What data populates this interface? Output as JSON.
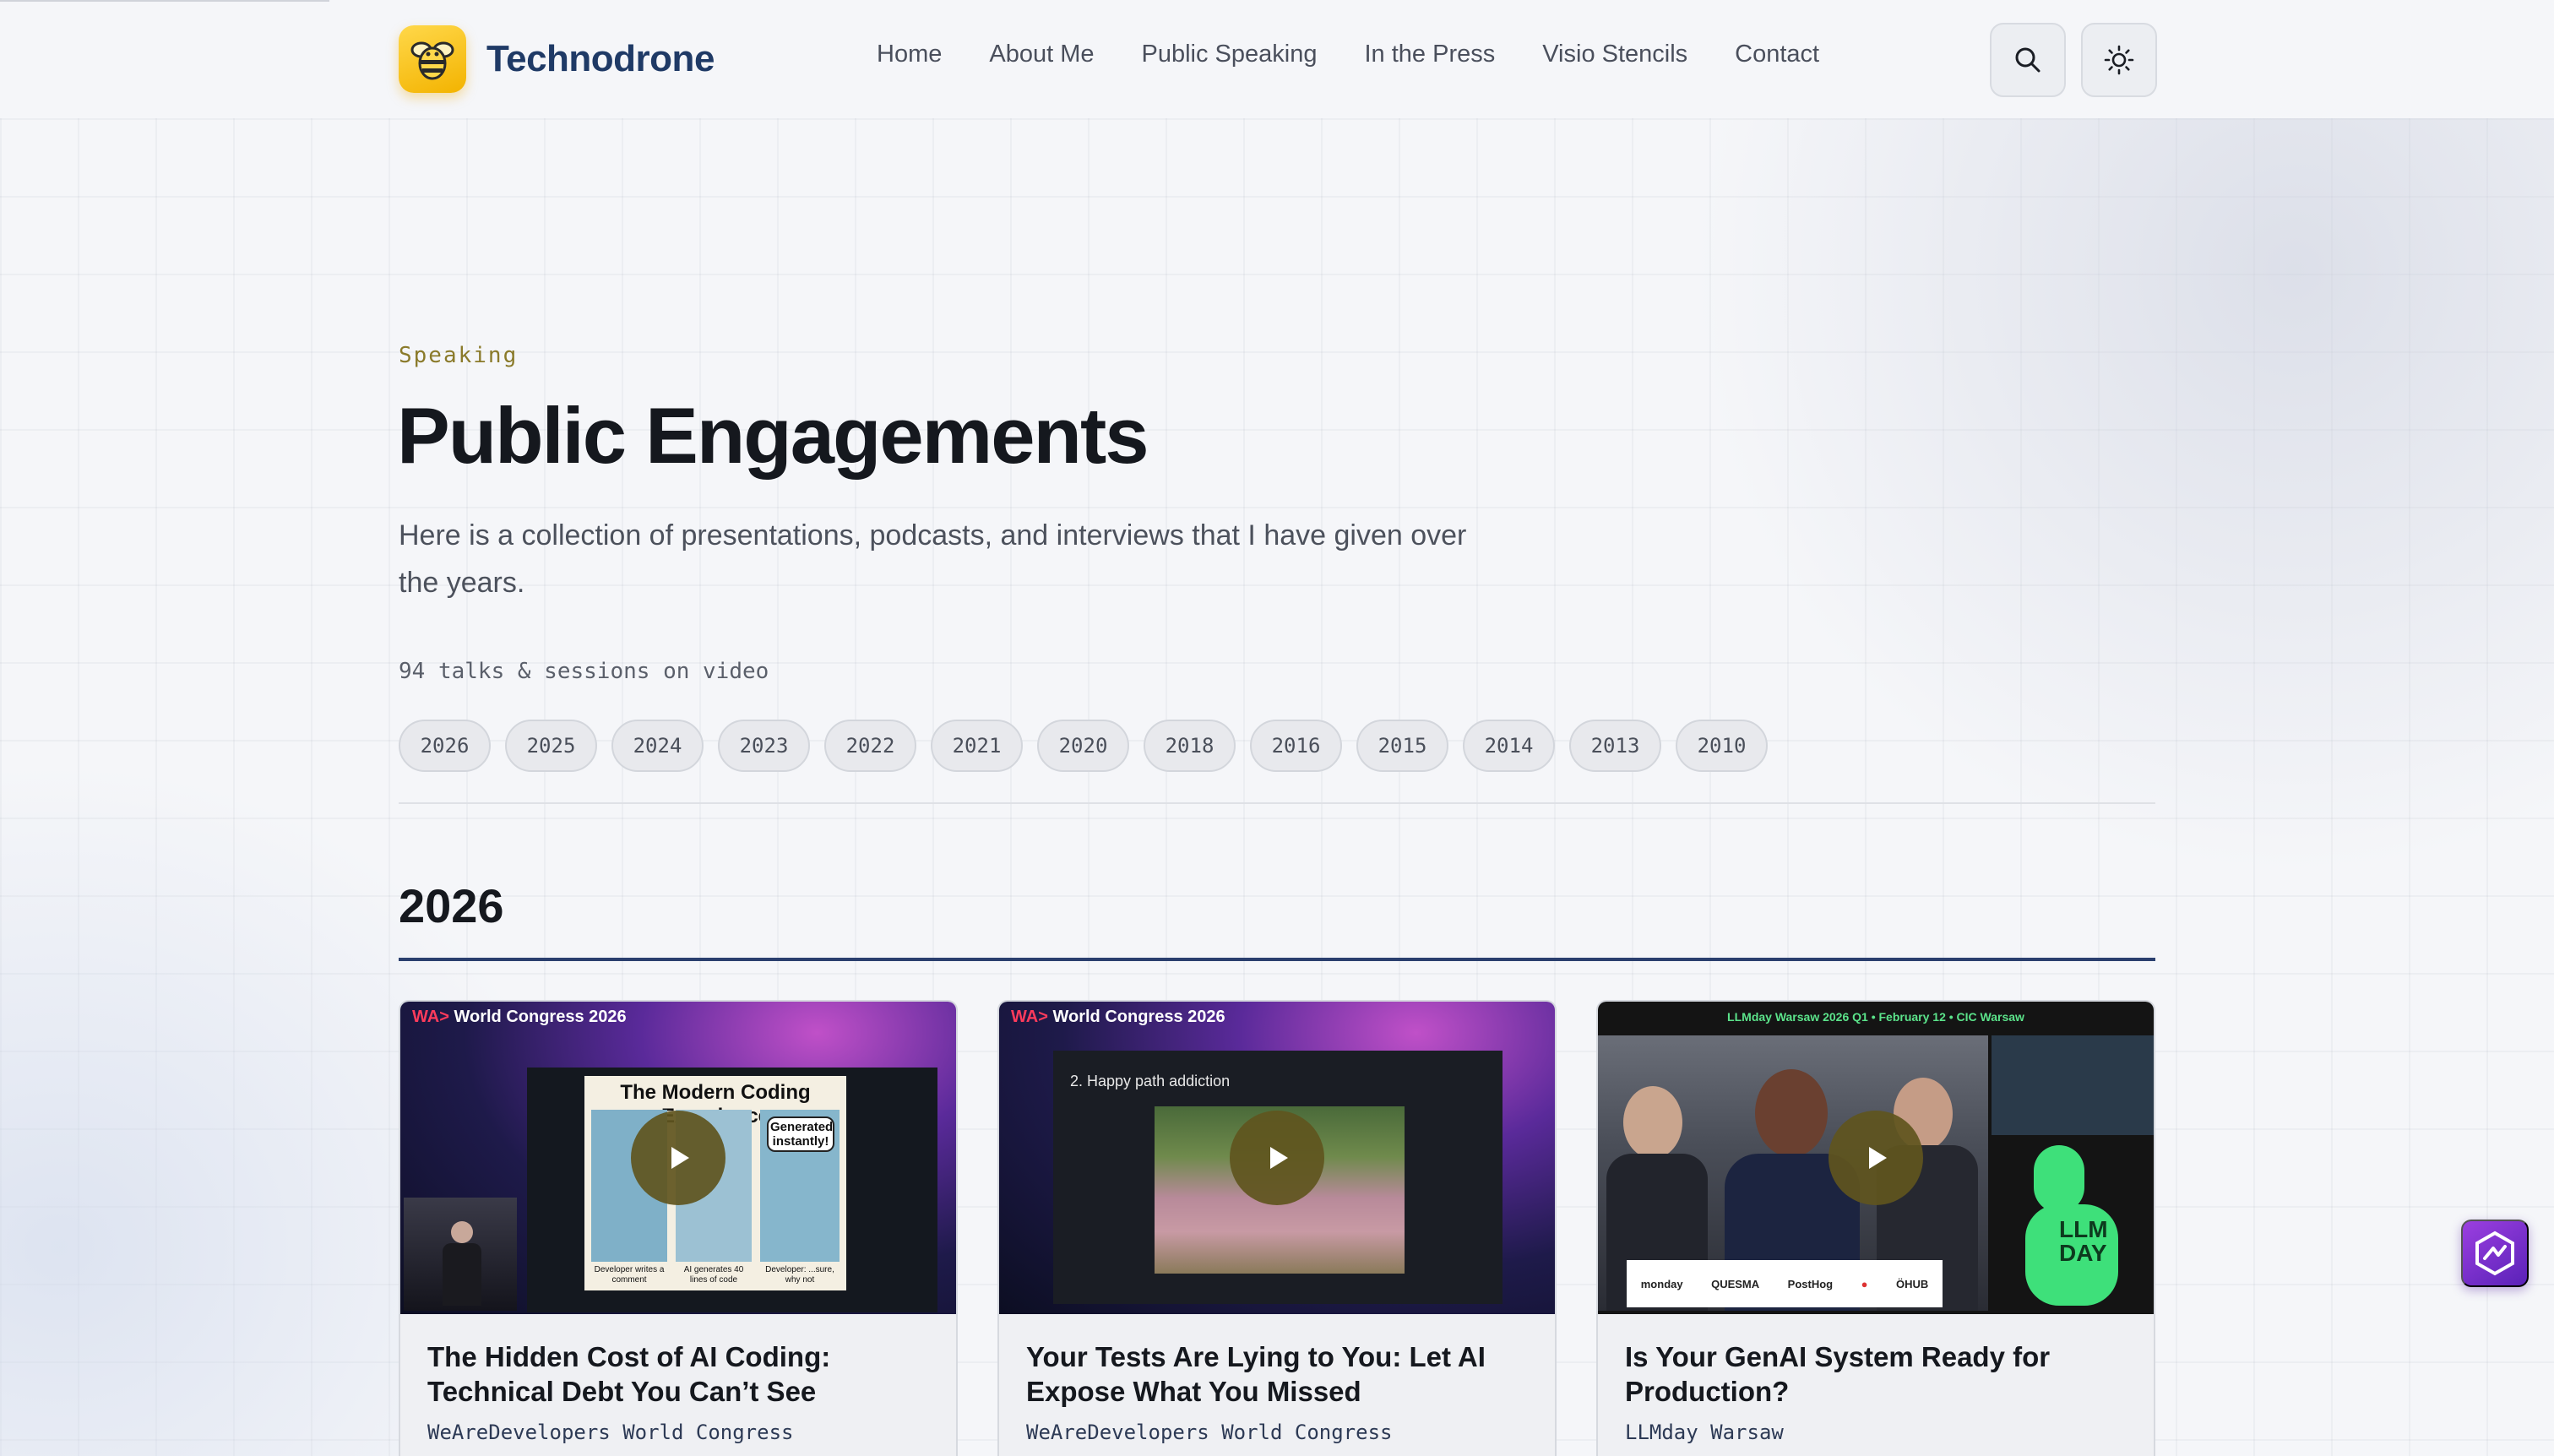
{
  "site": {
    "name": "Technodrone",
    "logo_icon": "bee-icon"
  },
  "nav": {
    "items": [
      {
        "label": "Home"
      },
      {
        "label": "About Me"
      },
      {
        "label": "Public Speaking"
      },
      {
        "label": "In the Press"
      },
      {
        "label": "Visio Stencils"
      },
      {
        "label": "Contact"
      }
    ],
    "search_icon": "search-icon",
    "theme_icon": "sun-icon"
  },
  "hero": {
    "eyebrow": "Speaking",
    "title": "Public Engagements",
    "intro": "Here is a collection of presentations, podcasts, and interviews that I have given over the years.",
    "count": "94 talks & sessions on video"
  },
  "years": [
    "2026",
    "2025",
    "2024",
    "2023",
    "2022",
    "2021",
    "2020",
    "2018",
    "2016",
    "2015",
    "2014",
    "2013",
    "2010"
  ],
  "section": {
    "year": "2026"
  },
  "cards": [
    {
      "title": "The Hidden Cost of AI Coding: Technical Debt You Can’t See",
      "event": "WeAreDevelopers World Congress",
      "thumb_brand": "World Congress 2026",
      "slide_title": "The Modern Coding Experience",
      "slide_bubble": "Generated instantly!",
      "slide_captions": [
        "Developer writes a comment",
        "AI generates 40 lines of code",
        "Developer: ...sure, why not"
      ]
    },
    {
      "title": "Your Tests Are Lying to You: Let AI Expose What You Missed",
      "event": "WeAreDevelopers World Congress",
      "thumb_brand": "World Congress 2026",
      "slide_title": "2. Happy path addiction"
    },
    {
      "title": "Is Your GenAI System Ready for Production?",
      "event": "LLMday Warsaw",
      "thumb_banner": "LLMday Warsaw 2026 Q1 • February 12 • CIC Warsaw",
      "thumb_badge": "LLM DAY",
      "sponsors": [
        "monday",
        "QUESMA",
        "PostHog",
        "●",
        "ÖHUB"
      ]
    }
  ],
  "colors": {
    "accent": "#2a3f6e",
    "brand": "#1f3a66",
    "eyebrow": "#8a7a2a",
    "play": "#5f551e"
  }
}
